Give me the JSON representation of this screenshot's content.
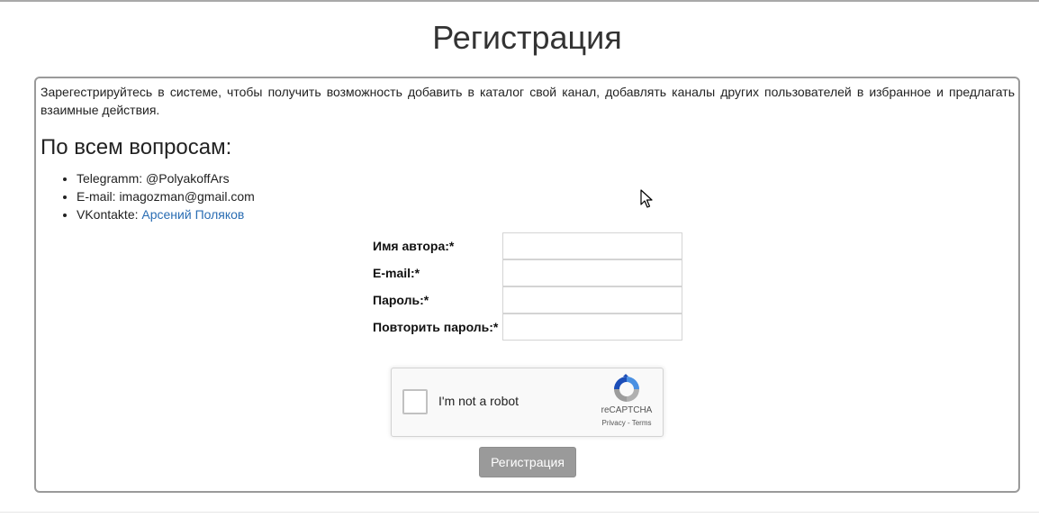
{
  "page": {
    "title": "Регистрация"
  },
  "intro": {
    "text": "Зарегестрируйтесь в системе, чтобы получить возможность добавить в каталог свой канал, добавлять каналы других пользователей в избранное и предлагать взаимные действия."
  },
  "contacts": {
    "heading": "По всем вопросам:",
    "telegram": "Telegramm: @PolyakoffArs",
    "email": "E-mail: imagozman@gmail.com",
    "vk_prefix": "VKontakte: ",
    "vk_link": "Арсений Поляков"
  },
  "form": {
    "author_label": "Имя автора:*",
    "author_value": "",
    "email_label": "E-mail:*",
    "email_value": "",
    "password_label": "Пароль:*",
    "password_value": "",
    "repeat_label": "Повторить пароль:*",
    "repeat_value": "",
    "submit_label": "Регистрация"
  },
  "recaptcha": {
    "label": "I'm not a robot",
    "brand": "reCAPTCHA",
    "privacy": "Privacy",
    "separator": " - ",
    "terms": "Terms"
  },
  "colors": {
    "link": "#2a6db3",
    "button": "#9a9a9a",
    "panel_border": "#9a9a9a"
  }
}
